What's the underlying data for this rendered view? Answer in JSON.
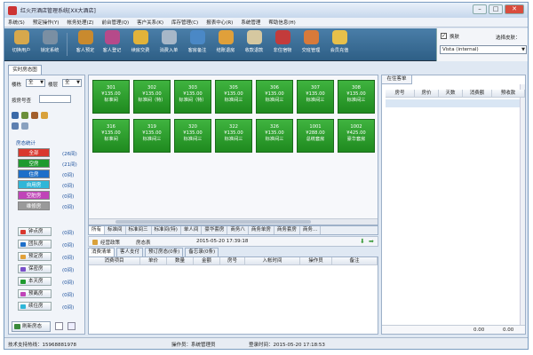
{
  "window": {
    "title": "红火开酒店管理系统[XX大酒店]",
    "controls": [
      "–",
      "□",
      "✕"
    ]
  },
  "menu": [
    "系统(S)",
    "预定操作(Y)",
    "帐务处理(Z)",
    "前台管理(Q)",
    "客户关系(K)",
    "库存管理(C)",
    "报表中心(R)",
    "系统管理",
    "帮助信息(H)"
  ],
  "toolbar": {
    "buttons": [
      {
        "label": "切换用户",
        "icon": "switch-user-icon",
        "color": "#d7a84c"
      },
      {
        "label": "锁定系统",
        "icon": "lock-icon",
        "color": "#7a8fa3"
      },
      {
        "label": "客人预定",
        "icon": "reservation-icon",
        "color": "#c98a2e"
      },
      {
        "label": "客人登记",
        "icon": "checkin-icon",
        "color": "#b64a8a"
      },
      {
        "label": "续房交费",
        "icon": "payment-icon",
        "color": "#e2b33a"
      },
      {
        "label": "消费入单",
        "icon": "order-icon",
        "color": "#a7b7c8"
      },
      {
        "label": "客房备注",
        "icon": "note-icon",
        "color": "#4a88c6"
      },
      {
        "label": "结账退房",
        "icon": "checkout-icon",
        "color": "#e0a03a"
      },
      {
        "label": "收款退款",
        "icon": "refund-icon",
        "color": "#d6c8a0"
      },
      {
        "label": "非住宿物",
        "icon": "goods-icon",
        "color": "#c33b3b"
      },
      {
        "label": "交班管理",
        "icon": "shift-icon",
        "color": "#d87a3a"
      },
      {
        "label": "会员充值",
        "icon": "member-card-icon",
        "color": "#e8c04a"
      }
    ],
    "skin_checkbox": "换肤",
    "skin_label": "选择皮肤：",
    "skin_value": "Vista (internal)"
  },
  "room_tab": "实时房态图",
  "left": {
    "floor_label": "楼栋",
    "floor_value": "全",
    "room_type_label": "楼层",
    "room_type_value": "全",
    "room_no_label": "按房号查",
    "stats_title": "房态统计",
    "stats": [
      {
        "label": "全部",
        "count": "(26间)",
        "color": "#d9372e",
        "text": "#fff"
      },
      {
        "label": "空房",
        "count": "(21间)",
        "color": "#1f9a2f",
        "text": "#fff"
      },
      {
        "label": "住房",
        "count": "(0间)",
        "color": "#1d6fc9",
        "text": "#fff"
      },
      {
        "label": "自用房",
        "count": "(0间)",
        "color": "#2fb6d8",
        "text": "#fff"
      },
      {
        "label": "空脏房",
        "count": "(0间)",
        "color": "#c044b8",
        "text": "#fff"
      },
      {
        "label": "维修房",
        "count": "(0间)",
        "color": "#9a9a9a",
        "text": "#fff"
      }
    ],
    "filters": [
      {
        "label": "钟点房",
        "count": "(0间)",
        "color": "#d9372e"
      },
      {
        "label": "团队房",
        "count": "(0间)",
        "color": "#1d6fc9"
      },
      {
        "label": "预定房",
        "count": "(0间)",
        "color": "#e2a13a"
      },
      {
        "label": "保密房",
        "count": "(0间)",
        "color": "#7a4fc9"
      },
      {
        "label": "本天房",
        "count": "(0间)",
        "color": "#1f9a2f"
      },
      {
        "label": "预离房",
        "count": "(0间)",
        "color": "#c044b8"
      },
      {
        "label": "续住房",
        "count": "(0间)",
        "color": "#2fb6d8"
      }
    ],
    "refresh_label": "刷新房态"
  },
  "rooms": [
    {
      "number": "301",
      "price": "¥135.00",
      "type": "标准间"
    },
    {
      "number": "302",
      "price": "¥135.00",
      "type": "标准间（特）"
    },
    {
      "number": "303",
      "price": "¥135.00",
      "type": "标准间（特）"
    },
    {
      "number": "305",
      "price": "¥135.00",
      "type": "标准间三"
    },
    {
      "number": "306",
      "price": "¥135.00",
      "type": "标准间三"
    },
    {
      "number": "307",
      "price": "¥135.00",
      "type": "标准间三"
    },
    {
      "number": "308",
      "price": "¥135.00",
      "type": "标准间三"
    },
    {
      "number": "316",
      "price": "¥135.00",
      "type": "标准间"
    },
    {
      "number": "319",
      "price": "¥135.00",
      "type": "标准间三"
    },
    {
      "number": "320",
      "price": "¥135.00",
      "type": "标准间三"
    },
    {
      "number": "322",
      "price": "¥135.00",
      "type": "标准间三"
    },
    {
      "number": "326",
      "price": "¥135.00",
      "type": "标准间三"
    },
    {
      "number": "1001",
      "price": "¥288.00",
      "type": "总统套房"
    },
    {
      "number": "1002",
      "price": "¥425.00",
      "type": "豪华套房"
    }
  ],
  "type_tabs": [
    "所有",
    "标准间",
    "标准间三",
    "标准间(特)",
    "单人间",
    "豪华套房",
    "商务八",
    "商务单房",
    "商务套房",
    "商务…"
  ],
  "info_bar": {
    "left": "经营政策",
    "right_label": "房态表",
    "datetime": "2015-05-20 17:39:18"
  },
  "consume_tabs": [
    "消费清单",
    "客人支付",
    "预订房态(0条)",
    "备忘录(0条)"
  ],
  "consume_columns": [
    "消费项目",
    "单价",
    "数量",
    "金额",
    "房号",
    "入帐时间",
    "操作员",
    "备注"
  ],
  "right_panel": {
    "tab": "在住客单",
    "columns": [
      "房号",
      "房价",
      "天数",
      "消费额",
      "预收款"
    ],
    "footer_values": [
      "0.00",
      "0.00"
    ]
  },
  "status_bar": {
    "support": "技术支持热线：15968881978",
    "operator": "操作员：系统管理员",
    "login_time": "登录时间：2015-05-20 17:18:53"
  }
}
